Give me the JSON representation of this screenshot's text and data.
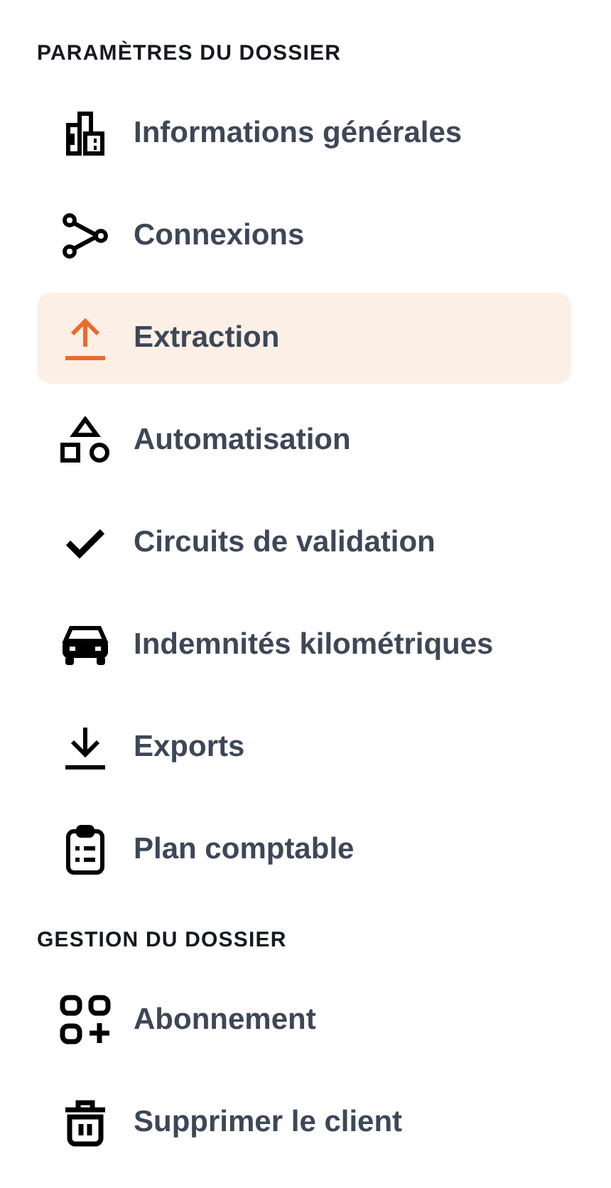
{
  "sections": [
    {
      "title": "PARAMÈTRES DU DOSSIER",
      "items": [
        {
          "label": "Informations générales",
          "selected": false
        },
        {
          "label": "Connexions",
          "selected": false
        },
        {
          "label": "Extraction",
          "selected": true
        },
        {
          "label": "Automatisation",
          "selected": false
        },
        {
          "label": "Circuits de validation",
          "selected": false
        },
        {
          "label": "Indemnités kilométriques",
          "selected": false
        },
        {
          "label": "Exports",
          "selected": false
        },
        {
          "label": "Plan comptable",
          "selected": false
        }
      ]
    },
    {
      "title": "GESTION DU DOSSIER",
      "items": [
        {
          "label": "Abonnement",
          "selected": false
        },
        {
          "label": "Supprimer le client",
          "selected": false
        }
      ]
    }
  ]
}
